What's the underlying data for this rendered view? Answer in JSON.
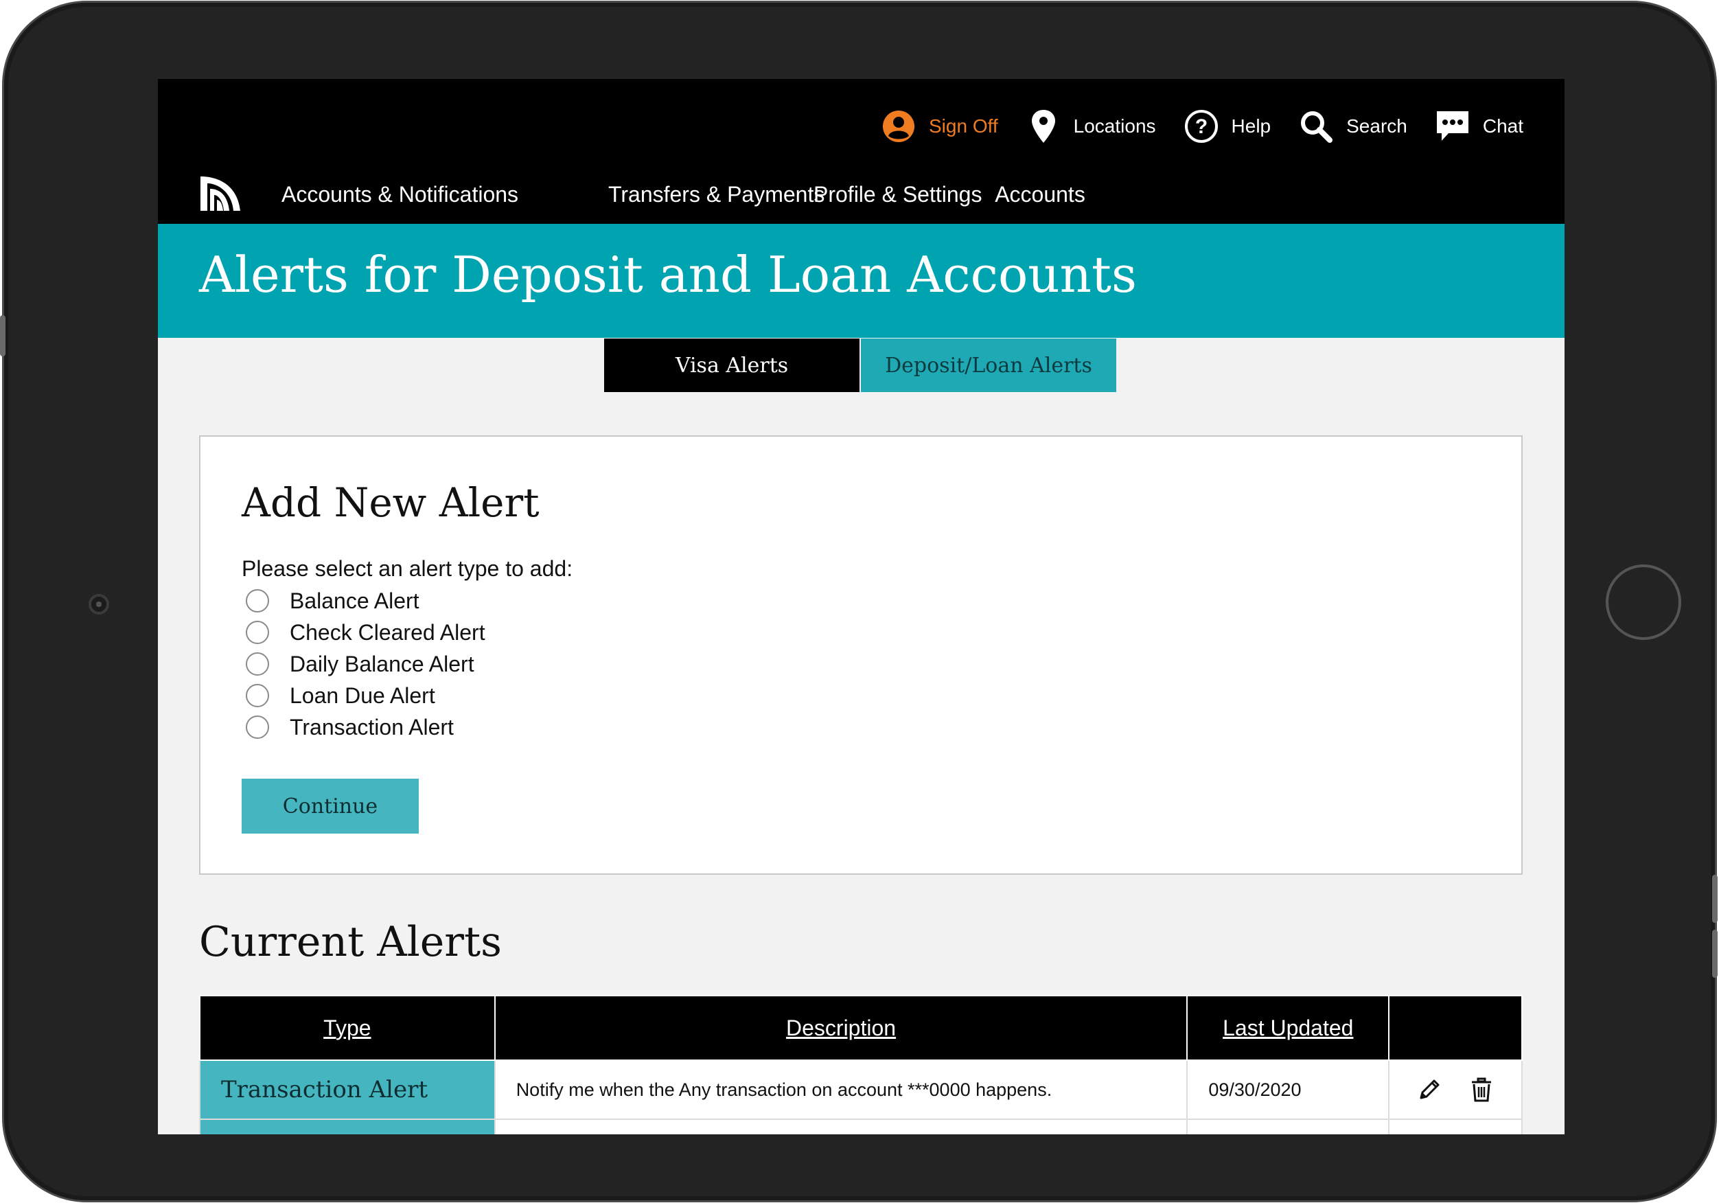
{
  "header": {
    "utility": [
      {
        "label": "Sign Off",
        "icon": "user-circle-icon"
      },
      {
        "label": "Locations",
        "icon": "map-pin-icon"
      },
      {
        "label": "Help",
        "icon": "help-circle-icon"
      },
      {
        "label": "Search",
        "icon": "search-icon"
      },
      {
        "label": "Chat",
        "icon": "chat-icon"
      }
    ],
    "nav": [
      "Accounts & Notifications",
      "Transfers & Payments",
      "Profile & Settings",
      "Accounts"
    ],
    "accent_color": "#f07c22"
  },
  "page": {
    "title": "Alerts for Deposit and Loan Accounts",
    "brand_color": "#00a3b0"
  },
  "tabs": [
    "Visa Alerts",
    "Deposit/Loan Alerts"
  ],
  "add_alert": {
    "title": "Add New Alert",
    "prompt": "Please select an alert type to add:",
    "options": [
      "Balance Alert",
      "Check Cleared Alert",
      "Daily Balance Alert",
      "Loan Due Alert",
      "Transaction Alert"
    ],
    "continue_label": "Continue"
  },
  "current_alerts": {
    "title": "Current Alerts",
    "columns": [
      "Type",
      "Description",
      "Last Updated"
    ],
    "rows": [
      {
        "type": "Transaction Alert",
        "description": "Notify me when the Any transaction on account ***0000 happens.",
        "last_updated": "09/30/2020",
        "actions": [
          "pencil-icon",
          "trash-icon"
        ]
      }
    ]
  }
}
